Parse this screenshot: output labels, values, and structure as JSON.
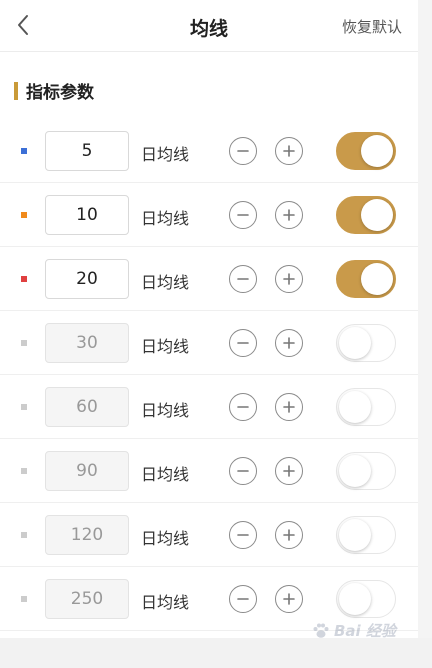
{
  "header": {
    "title": "均线",
    "reset_label": "恢复默认",
    "back_icon": "chevron-left-icon"
  },
  "section": {
    "title": "指标参数",
    "accent_color": "#c99a38"
  },
  "rows": [
    {
      "value": "5",
      "label": "日均线",
      "enabled": true,
      "dot_color": "#3c6fd6"
    },
    {
      "value": "10",
      "label": "日均线",
      "enabled": true,
      "dot_color": "#f08a1c"
    },
    {
      "value": "20",
      "label": "日均线",
      "enabled": true,
      "dot_color": "#e04040"
    },
    {
      "value": "30",
      "label": "日均线",
      "enabled": false,
      "dot_color": "#cccccc"
    },
    {
      "value": "60",
      "label": "日均线",
      "enabled": false,
      "dot_color": "#cccccc"
    },
    {
      "value": "90",
      "label": "日均线",
      "enabled": false,
      "dot_color": "#cccccc"
    },
    {
      "value": "120",
      "label": "日均线",
      "enabled": false,
      "dot_color": "#cccccc"
    },
    {
      "value": "250",
      "label": "日均线",
      "enabled": false,
      "dot_color": "#cccccc"
    }
  ],
  "toggle_on_color": "#c99a4a",
  "watermark": {
    "text": "Bai 经验",
    "icon": "paw-icon"
  }
}
